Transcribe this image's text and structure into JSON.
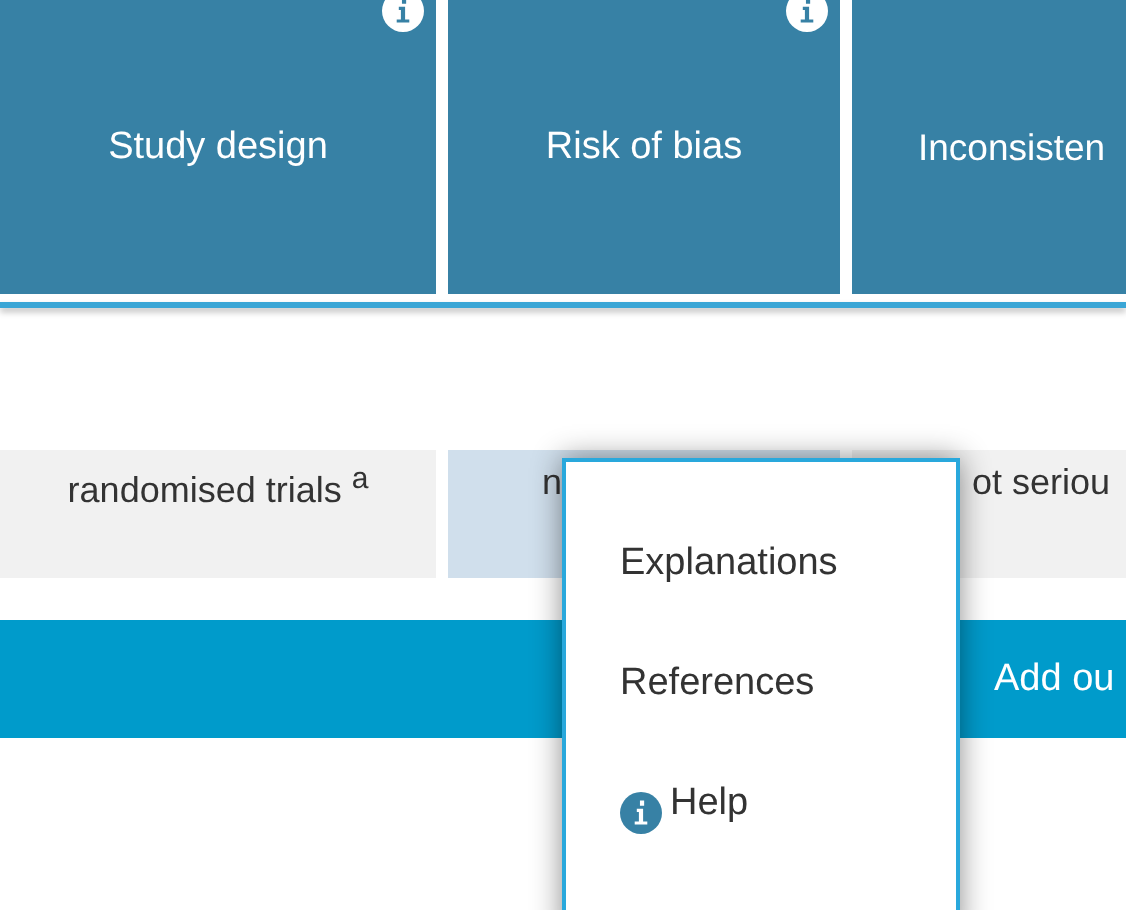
{
  "header_columns": [
    {
      "label": "Study design",
      "info": true
    },
    {
      "label": "Risk of bias",
      "info": true
    },
    {
      "label": "Inconsisten",
      "info": false
    }
  ],
  "cells": [
    {
      "text": "randomised trials $^{a}$",
      "selected": false
    },
    {
      "text": "n",
      "selected": true
    },
    {
      "text": "ot seriou",
      "selected": false
    }
  ],
  "add_button": {
    "label": "Add ou"
  },
  "menu": {
    "items": [
      {
        "label": "Explanations",
        "kind": "plain"
      },
      {
        "label": "References",
        "kind": "plain"
      },
      {
        "label": "Help",
        "kind": "help"
      }
    ]
  }
}
